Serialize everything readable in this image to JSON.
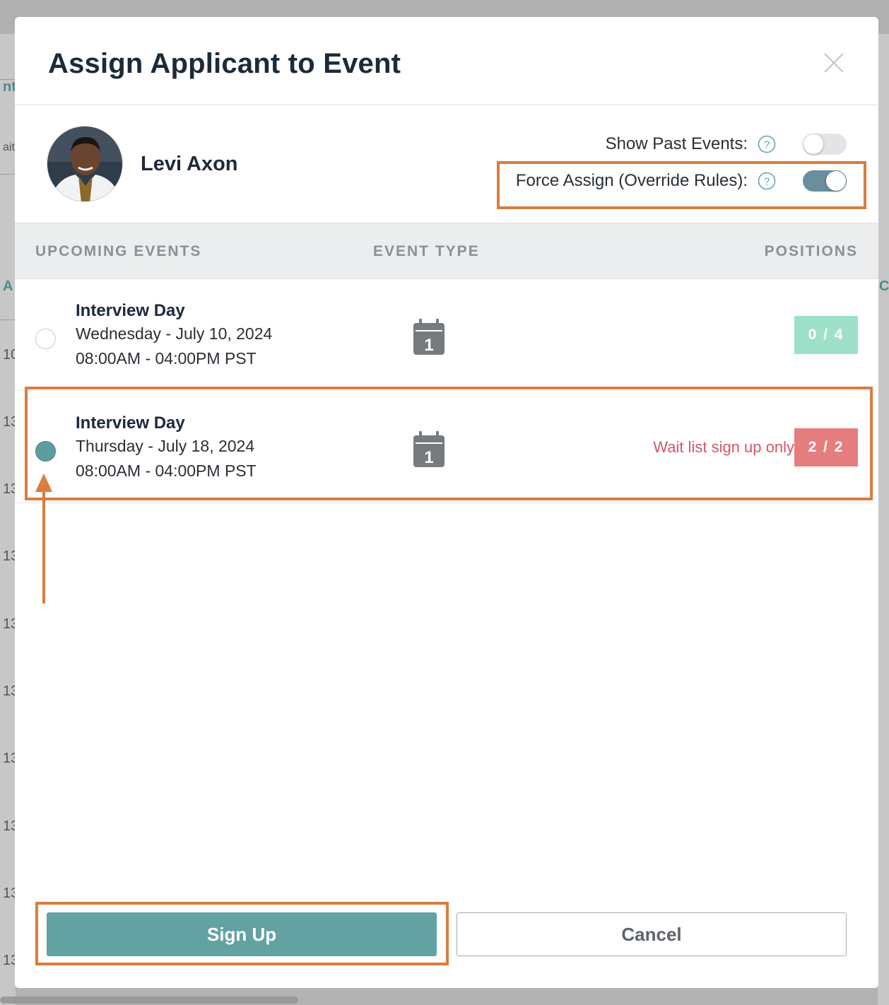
{
  "modal": {
    "title": "Assign Applicant to Event"
  },
  "applicant": {
    "name": "Levi Axon"
  },
  "options": {
    "show_past_label": "Show Past Events:",
    "show_past_on": false,
    "force_assign_label": "Force Assign (Override Rules):",
    "force_assign_on": true
  },
  "table": {
    "headers": [
      "UPCOMING EVENTS",
      "EVENT TYPE",
      "POSITIONS"
    ],
    "events": [
      {
        "name": "Interview Day",
        "date": "Wednesday - July 10, 2024",
        "time": "08:00AM - 04:00PM PST",
        "type_icon": "calendar-icon",
        "type_number": "1",
        "positions": "0 / 4",
        "status": "",
        "selected": false
      },
      {
        "name": "Interview Day",
        "date": "Thursday - July 18, 2024",
        "time": "08:00AM - 04:00PM PST",
        "type_icon": "calendar-icon",
        "type_number": "1",
        "positions": "2 / 2",
        "status": "Wait list sign up only",
        "selected": true
      }
    ]
  },
  "buttons": {
    "primary": "Sign Up",
    "secondary": "Cancel"
  },
  "background_fragments": {
    "left": [
      "nt",
      "aitl",
      "A",
      "10",
      "13",
      "13",
      "13",
      "13",
      "13",
      "13",
      "13",
      "13",
      "13"
    ],
    "right": [
      "C"
    ]
  },
  "colors": {
    "accent": "#62a2a3",
    "toggle_on": "#6a8e9d",
    "available_badge": "#9fe1c8",
    "full_badge": "#e67d7e",
    "waitlist_text": "#d6556a",
    "annotation": "#d97d40"
  }
}
